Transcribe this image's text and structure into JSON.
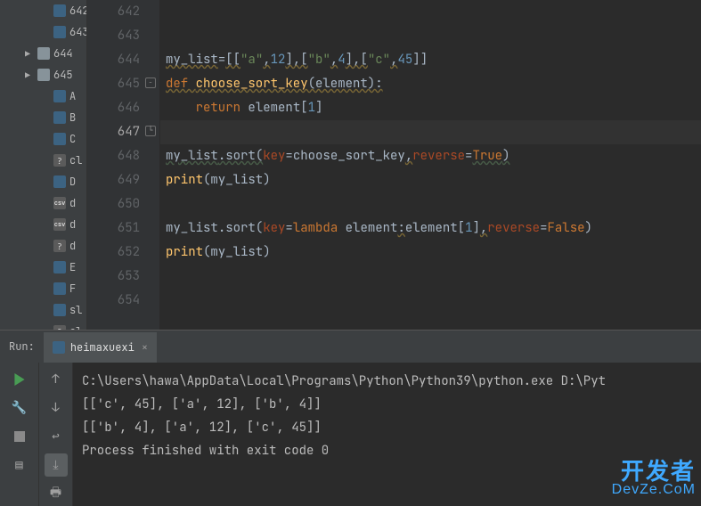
{
  "tree": [
    {
      "label": "642",
      "type": "py-partial"
    },
    {
      "label": "643",
      "type": "py-partial"
    },
    {
      "label": "644",
      "type": "folder",
      "collapsible": true
    },
    {
      "label": "645",
      "type": "folder",
      "collapsible": true
    },
    {
      "label": "A",
      "type": "py"
    },
    {
      "label": "B",
      "type": "py"
    },
    {
      "label": "C",
      "type": "py"
    },
    {
      "label": "cl",
      "type": "unknown"
    },
    {
      "label": "D",
      "type": "py"
    },
    {
      "label": "d",
      "type": "csv"
    },
    {
      "label": "d",
      "type": "csv"
    },
    {
      "label": "d",
      "type": "unknown"
    },
    {
      "label": "E",
      "type": "py"
    },
    {
      "label": "F",
      "type": "py"
    },
    {
      "label": "sl",
      "type": "py"
    },
    {
      "label": "cl",
      "type": "unknown"
    }
  ],
  "line_numbers": [
    642,
    643,
    644,
    645,
    646,
    647,
    648,
    649,
    650,
    651,
    652,
    653,
    654
  ],
  "current_line": 647,
  "code": {
    "l644": {
      "var": "my_list",
      "assign": "=",
      "lst": "[[",
      "s1": "\"a\"",
      "c1": ",",
      "n1": "12",
      "b1": "],[",
      "s2": "\"b\"",
      "c2": ",",
      "n2": "4",
      "b2": "],[",
      "s3": "\"c\"",
      "c3": ",",
      "n3": "45",
      "b3": "]]"
    },
    "l645": {
      "def": "def ",
      "fn": "choose_sort_key",
      "paren": "(element):"
    },
    "l646": {
      "ret": "return ",
      "expr": "element[",
      "idx": "1",
      "close": "]"
    },
    "l648": {
      "var": "my_list",
      "dot": ".sort(",
      "kwarg1": "key",
      "eq1": "=",
      "fn": "choose_sort_key",
      "c": ",",
      "kwarg2": "reverse",
      "eq2": "=",
      "val": "True",
      "close": ")"
    },
    "l649": {
      "fn": "print",
      "open": "(",
      "arg": "my_list",
      "close": ")"
    },
    "l651": {
      "var": "my_list",
      "dot": ".sort(",
      "kwarg1": "key",
      "eq1": "=",
      "lam": "lambda ",
      "lamarg": "element",
      "col": ":",
      "expr": "element[",
      "idx": "1",
      "br": "]",
      "c": ",",
      "kwarg2": "reverse",
      "eq2": "=",
      "val": "False",
      "close": ")"
    },
    "l652": {
      "fn": "print",
      "open": "(",
      "arg": "my_list",
      "close": ")"
    }
  },
  "run": {
    "label": "Run:",
    "tab": "heimaxuexi",
    "output": [
      "C:\\Users\\hawa\\AppData\\Local\\Programs\\Python\\Python39\\python.exe D:\\Pyt",
      "[['c', 45], ['a', 12], ['b', 4]]",
      "[['b', 4], ['a', 12], ['c', 45]]",
      "",
      "Process finished with exit code 0"
    ]
  },
  "watermark": {
    "l1": "开发者",
    "l2": "DevZe.CoM"
  }
}
